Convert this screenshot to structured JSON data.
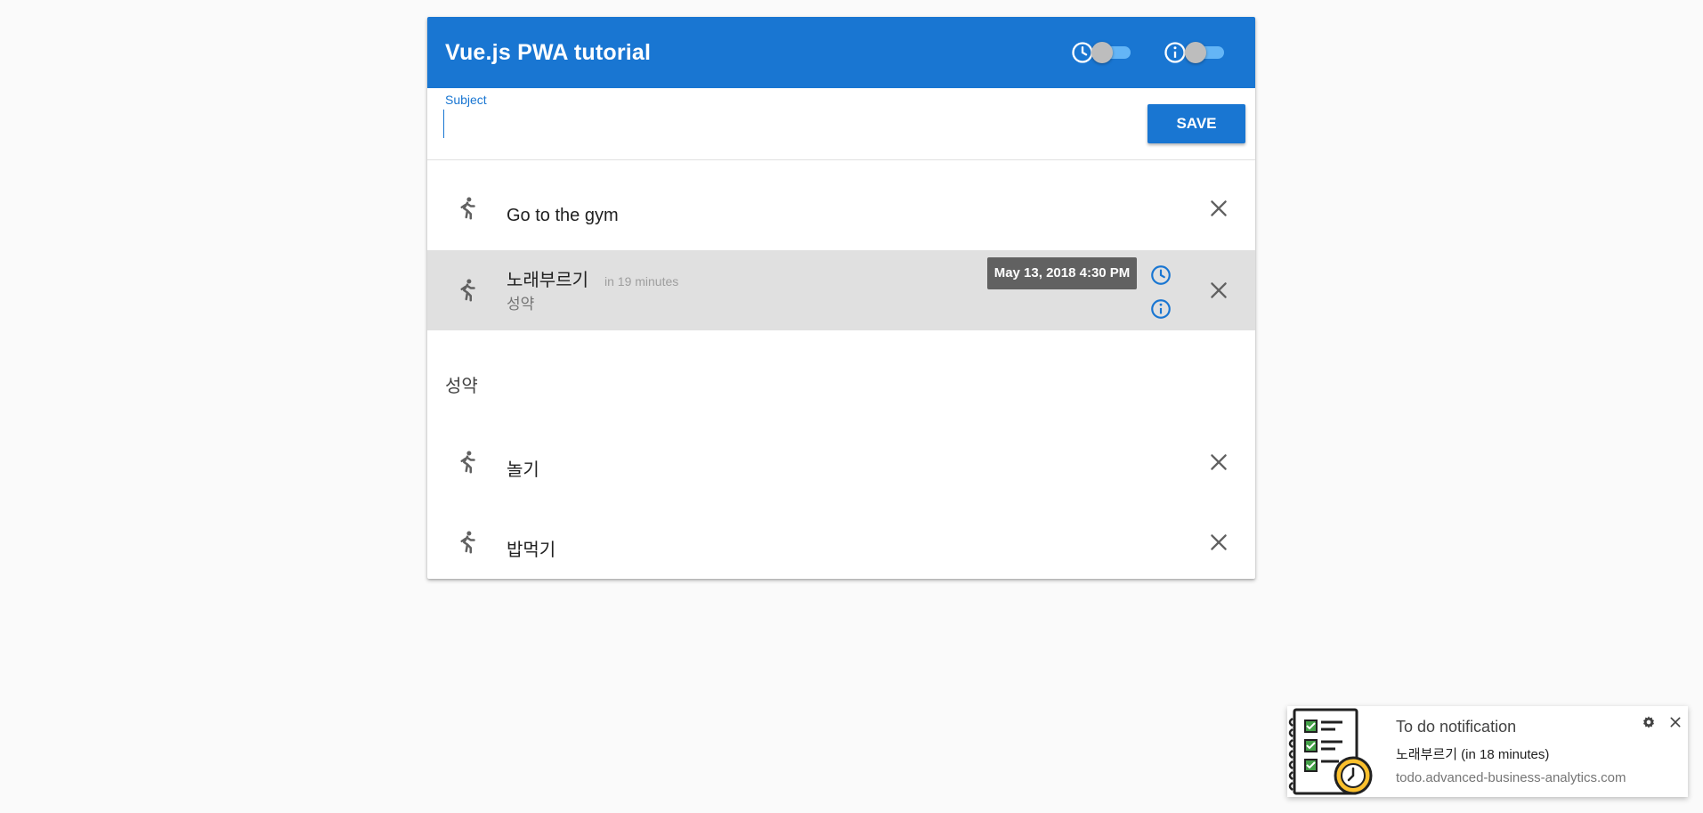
{
  "toolbar": {
    "title": "Vue.js PWA tutorial",
    "clock_toggle_on": false,
    "info_toggle_on": false
  },
  "form": {
    "subject_label": "Subject",
    "subject_value": "",
    "save_label": "SAVE"
  },
  "todos": [
    {
      "title": "Go to the gym",
      "icon": "run-icon"
    },
    {
      "title": "노래부르기",
      "meta": "in 19 minutes",
      "subtitle": "성약",
      "icon": "run-icon",
      "highlighted": true
    }
  ],
  "group": {
    "header": "성약",
    "items": [
      {
        "title": "놀기",
        "icon": "run-icon"
      },
      {
        "title": "밥먹기",
        "icon": "run-icon"
      }
    ]
  },
  "tooltip": {
    "text": "May 13, 2018 4:30 PM"
  },
  "notification": {
    "title": "To do notification",
    "body": "노래부르기 (in 18 minutes)",
    "source": "todo.advanced-business-analytics.com"
  },
  "colors": {
    "primary": "#1976d2",
    "background": "#fafafa",
    "highlight_row": "#e0e0e0",
    "icon_gray": "#616161",
    "tooltip_bg": "#616161"
  }
}
